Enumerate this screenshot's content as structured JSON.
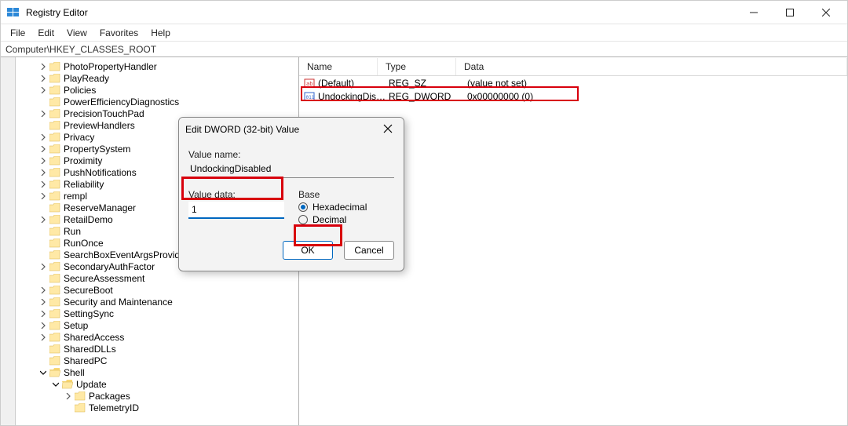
{
  "titlebar": {
    "title": "Registry Editor"
  },
  "menubar": {
    "items": [
      "File",
      "Edit",
      "View",
      "Favorites",
      "Help"
    ]
  },
  "addressbar": {
    "path": "Computer\\HKEY_CLASSES_ROOT"
  },
  "tree": {
    "items": [
      {
        "label": "PhotoPropertyHandler",
        "indent": 0,
        "expander": ">"
      },
      {
        "label": "PlayReady",
        "indent": 0,
        "expander": ">"
      },
      {
        "label": "Policies",
        "indent": 0,
        "expander": ">"
      },
      {
        "label": "PowerEfficiencyDiagnostics",
        "indent": 0,
        "expander": ""
      },
      {
        "label": "PrecisionTouchPad",
        "indent": 0,
        "expander": ">"
      },
      {
        "label": "PreviewHandlers",
        "indent": 0,
        "expander": ""
      },
      {
        "label": "Privacy",
        "indent": 0,
        "expander": ">"
      },
      {
        "label": "PropertySystem",
        "indent": 0,
        "expander": ">"
      },
      {
        "label": "Proximity",
        "indent": 0,
        "expander": ">"
      },
      {
        "label": "PushNotifications",
        "indent": 0,
        "expander": ">"
      },
      {
        "label": "Reliability",
        "indent": 0,
        "expander": ">"
      },
      {
        "label": "rempl",
        "indent": 0,
        "expander": ">"
      },
      {
        "label": "ReserveManager",
        "indent": 0,
        "expander": ""
      },
      {
        "label": "RetailDemo",
        "indent": 0,
        "expander": ">"
      },
      {
        "label": "Run",
        "indent": 0,
        "expander": ""
      },
      {
        "label": "RunOnce",
        "indent": 0,
        "expander": ""
      },
      {
        "label": "SearchBoxEventArgsProvider",
        "indent": 0,
        "expander": ""
      },
      {
        "label": "SecondaryAuthFactor",
        "indent": 0,
        "expander": ">"
      },
      {
        "label": "SecureAssessment",
        "indent": 0,
        "expander": ""
      },
      {
        "label": "SecureBoot",
        "indent": 0,
        "expander": ">"
      },
      {
        "label": "Security and Maintenance",
        "indent": 0,
        "expander": ">"
      },
      {
        "label": "SettingSync",
        "indent": 0,
        "expander": ">"
      },
      {
        "label": "Setup",
        "indent": 0,
        "expander": ">"
      },
      {
        "label": "SharedAccess",
        "indent": 0,
        "expander": ">"
      },
      {
        "label": "SharedDLLs",
        "indent": 0,
        "expander": ""
      },
      {
        "label": "SharedPC",
        "indent": 0,
        "expander": ""
      },
      {
        "label": "Shell",
        "indent": 0,
        "expander": "v",
        "open": true
      },
      {
        "label": "Update",
        "indent": 1,
        "expander": "v",
        "open": true
      },
      {
        "label": "Packages",
        "indent": 2,
        "expander": ">"
      },
      {
        "label": "TelemetryID",
        "indent": 2,
        "expander": ""
      }
    ]
  },
  "list": {
    "headers": {
      "name": "Name",
      "type": "Type",
      "data": "Data"
    },
    "rows": [
      {
        "icon": "string",
        "name": "(Default)",
        "type": "REG_SZ",
        "data": "(value not set)"
      },
      {
        "icon": "dword",
        "name": "UndockingDisab…",
        "type": "REG_DWORD",
        "data": "0x00000000 (0)"
      }
    ]
  },
  "dialog": {
    "title": "Edit DWORD (32-bit) Value",
    "value_name_label": "Value name:",
    "value_name": "UndockingDisabled",
    "value_data_label": "Value data:",
    "value_data": "1",
    "base_label": "Base",
    "radio_hex": "Hexadecimal",
    "radio_dec": "Decimal",
    "ok": "OK",
    "cancel": "Cancel"
  }
}
